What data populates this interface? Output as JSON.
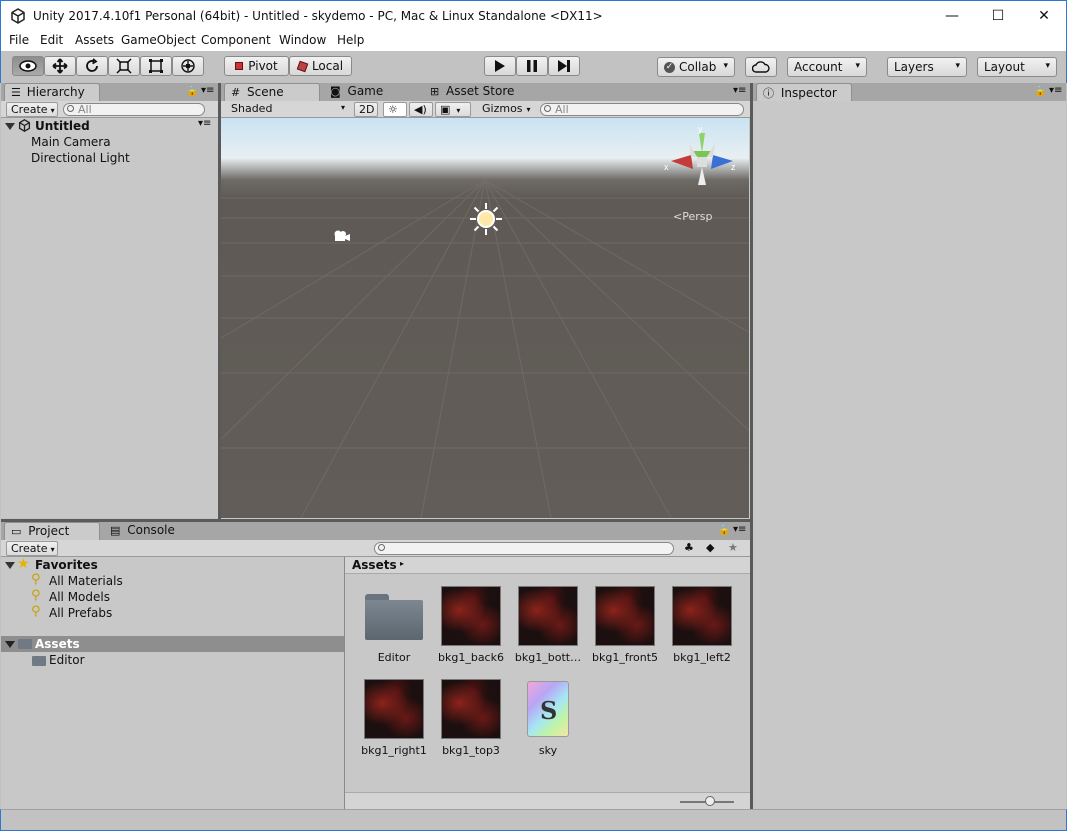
{
  "window": {
    "title": "Unity 2017.4.10f1 Personal (64bit) - Untitled - skydemo - PC, Mac & Linux Standalone <DX11>",
    "controls": {
      "minimize": "—",
      "maximize": "☐",
      "close": "✕"
    }
  },
  "menu": [
    "File",
    "Edit",
    "Assets",
    "GameObject",
    "Component",
    "Window",
    "Help"
  ],
  "toolbar": {
    "pivot": "Pivot",
    "local": "Local",
    "collab": "Collab",
    "account": "Account",
    "layers": "Layers",
    "layout": "Layout"
  },
  "hierarchy": {
    "tab": "Hierarchy",
    "create": "Create",
    "search_placeholder": "All",
    "scene": "Untitled",
    "items": [
      "Main Camera",
      "Directional Light"
    ]
  },
  "scene": {
    "tabs": [
      "Scene",
      "Game",
      "Asset Store"
    ],
    "shading": "Shaded",
    "mode_2d": "2D",
    "gizmos": "Gizmos",
    "search_placeholder": "All",
    "persp": "Persp",
    "axes": {
      "x": "x",
      "y": "y",
      "z": "z"
    }
  },
  "inspector": {
    "tab": "Inspector"
  },
  "project": {
    "tabs": [
      "Project",
      "Console"
    ],
    "create": "Create",
    "favorites_label": "Favorites",
    "favorites": [
      "All Materials",
      "All Models",
      "All Prefabs"
    ],
    "assets_label": "Assets",
    "asset_folders": [
      "Editor"
    ],
    "breadcrumb": "Assets",
    "files": [
      "Editor",
      "bkg1_back6",
      "bkg1_bott…",
      "bkg1_front5",
      "bkg1_left2",
      "bkg1_right1",
      "bkg1_top3",
      "sky"
    ]
  },
  "colors": {
    "window_border": "#2b78d4",
    "panel_bg": "#c2c2c2",
    "selection": "#8e8e8e"
  }
}
